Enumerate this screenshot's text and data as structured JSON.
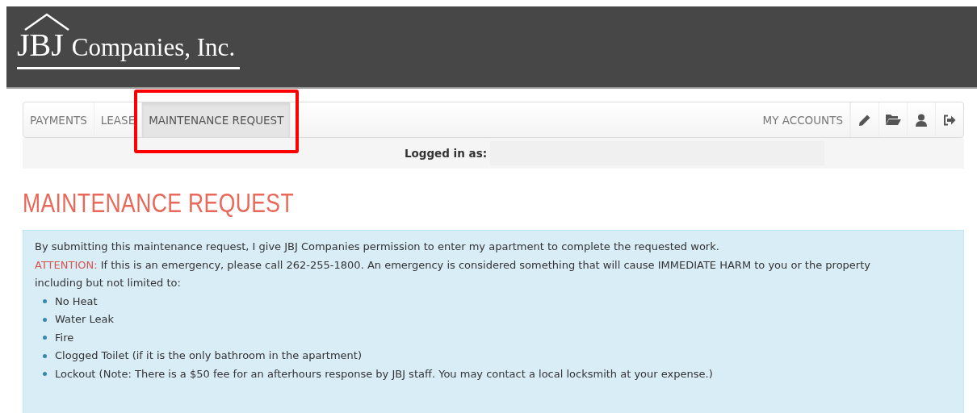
{
  "header": {
    "logo_text": "JBJ",
    "logo_company": "Companies, Inc."
  },
  "nav": {
    "tabs": [
      {
        "label": "PAYMENTS",
        "selected": false,
        "highlighted": false
      },
      {
        "label": "LEASE",
        "selected": false,
        "highlighted": false
      },
      {
        "label": "MAINTENANCE REQUEST",
        "selected": true,
        "highlighted": true
      }
    ],
    "right_link": "MY ACCOUNTS",
    "icon_buttons": [
      {
        "kind": "pencil"
      },
      {
        "kind": "folder"
      },
      {
        "kind": "user"
      },
      {
        "kind": "signout"
      }
    ]
  },
  "login_bar": {
    "label": "Logged in as:"
  },
  "page_title": "MAINTENANCE REQUEST",
  "notice": {
    "intro": "By submitting this maintenance request, I give JBJ Companies permission to enter my apartment to complete the requested work.",
    "attention_label": "ATTENTION:",
    "attention_text": " If this is an emergency, please call 262-255-1800.  An emergency is considered something that will cause IMMEDIATE HARM to you or the property including but not limited to:",
    "items": [
      "No Heat",
      "Water Leak",
      "Fire",
      "Clogged Toilet (if it is the only bathroom in the apartment)",
      "Lockout (Note: There is a $50 fee for an afterhours response by JBJ staff.  You may contact a local locksmith at your expense.)"
    ]
  }
}
